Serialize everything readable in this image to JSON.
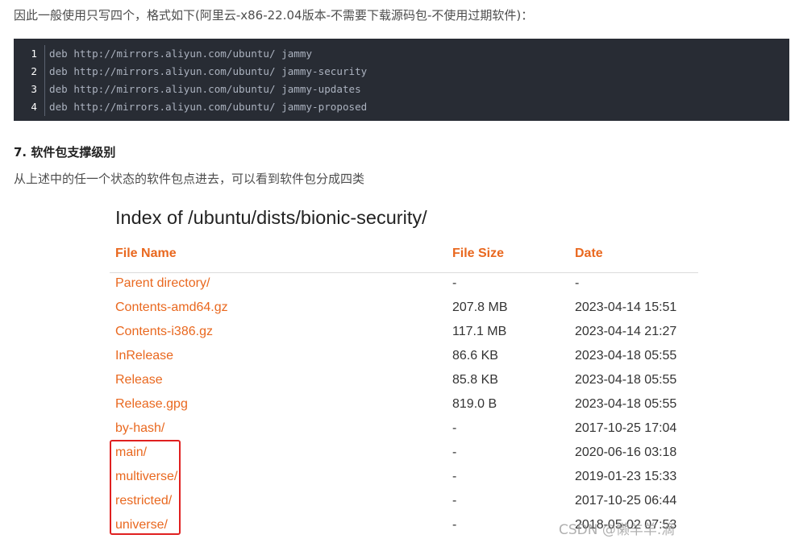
{
  "intro": "因此一般使用只写四个，格式如下(阿里云-x86-22.04版本-不需要下载源码包-不使用过期软件)：",
  "code_lines": [
    {
      "num": "1",
      "text": "deb http://mirrors.aliyun.com/ubuntu/ jammy"
    },
    {
      "num": "2",
      "text": "deb http://mirrors.aliyun.com/ubuntu/ jammy-security"
    },
    {
      "num": "3",
      "text": "deb http://mirrors.aliyun.com/ubuntu/ jammy-updates"
    },
    {
      "num": "4",
      "text": "deb http://mirrors.aliyun.com/ubuntu/ jammy-proposed"
    }
  ],
  "section_title": "7. 软件包支撑级别",
  "section_desc": "从上述中的任一个状态的软件包点进去，可以看到软件包分成四类",
  "index": {
    "title": "Index of /ubuntu/dists/bionic-security/",
    "headers": {
      "name": "File Name",
      "size": "File Size",
      "date": "Date"
    },
    "rows": [
      {
        "name": "Parent directory/",
        "size": "-",
        "date": "-"
      },
      {
        "name": "Contents-amd64.gz",
        "size": "207.8 MB",
        "date": "2023-04-14 15:51"
      },
      {
        "name": "Contents-i386.gz",
        "size": "117.1 MB",
        "date": "2023-04-14 21:27"
      },
      {
        "name": "InRelease",
        "size": "86.6 KB",
        "date": "2023-04-18 05:55"
      },
      {
        "name": "Release",
        "size": "85.8 KB",
        "date": "2023-04-18 05:55"
      },
      {
        "name": "Release.gpg",
        "size": "819.0 B",
        "date": "2023-04-18 05:55"
      },
      {
        "name": "by-hash/",
        "size": "-",
        "date": "2017-10-25 17:04"
      },
      {
        "name": "main/",
        "size": "-",
        "date": "2020-06-16 03:18"
      },
      {
        "name": "multiverse/",
        "size": "-",
        "date": "2019-01-23 15:33"
      },
      {
        "name": "restricted/",
        "size": "-",
        "date": "2017-10-25 06:44"
      },
      {
        "name": "universe/",
        "size": "-",
        "date": "2018-05-02 07:53"
      }
    ]
  },
  "watermark": "CSDN @懒羊羊.滴",
  "colors": {
    "link": "#e9681f",
    "highlight": "#e02020",
    "code_bg": "#282c34"
  }
}
